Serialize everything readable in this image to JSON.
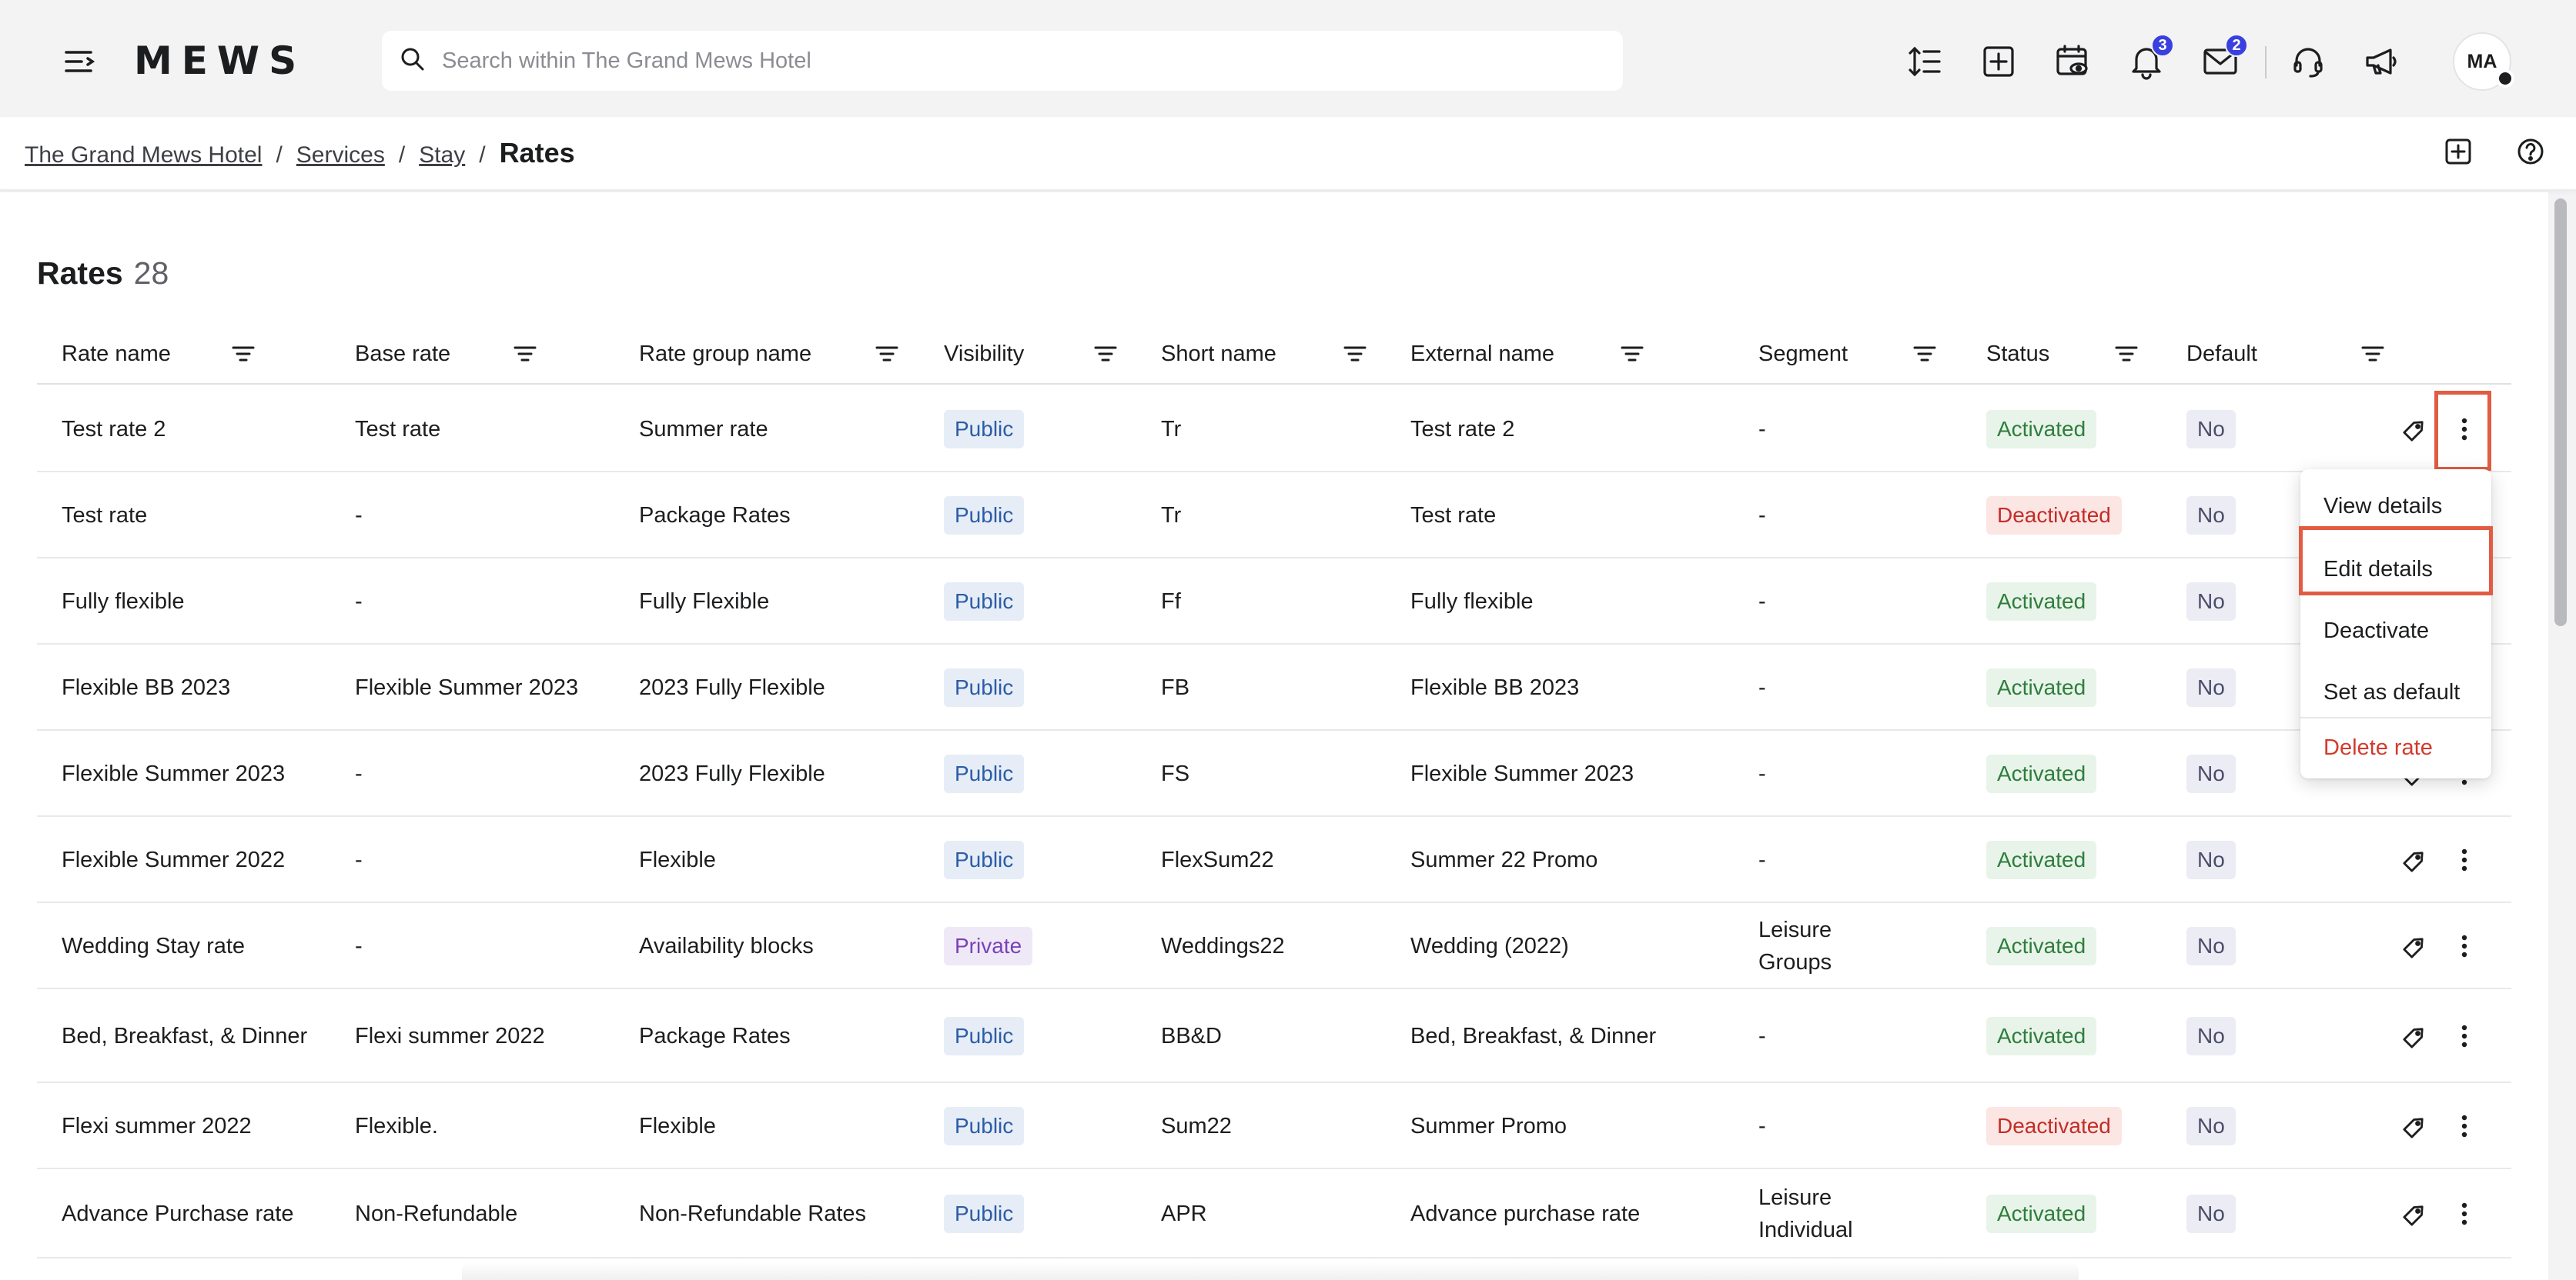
{
  "app": {
    "logo_text": "MEWS",
    "search_placeholder": "Search within The Grand Mews Hotel",
    "notifications_count": "3",
    "messages_count": "2",
    "avatar_initials": "MA"
  },
  "breadcrumb": {
    "items": [
      "The Grand Mews Hotel",
      "Services",
      "Stay"
    ],
    "separator": "/",
    "current": "Rates"
  },
  "page": {
    "title": "Rates",
    "count": "28"
  },
  "table": {
    "columns": [
      "Rate name",
      "Base rate",
      "Rate group name",
      "Visibility",
      "Short name",
      "External name",
      "Segment",
      "Status",
      "Default"
    ],
    "rows": [
      {
        "name": "Test rate 2",
        "base": "Test rate",
        "group": "Summer rate",
        "visibility": "Public",
        "short": "Tr",
        "external": "Test rate 2",
        "segment": "-",
        "status": "Activated",
        "default": "No"
      },
      {
        "name": "Test rate",
        "base": "-",
        "group": "Package Rates",
        "visibility": "Public",
        "short": "Tr",
        "external": "Test rate",
        "segment": "-",
        "status": "Deactivated",
        "default": "No"
      },
      {
        "name": "Fully flexible",
        "base": "-",
        "group": "Fully Flexible",
        "visibility": "Public",
        "short": "Ff",
        "external": "Fully flexible",
        "segment": "-",
        "status": "Activated",
        "default": "No"
      },
      {
        "name": "Flexible BB 2023",
        "base": "Flexible Summer 2023",
        "group": "2023 Fully Flexible",
        "visibility": "Public",
        "short": "FB",
        "external": "Flexible BB 2023",
        "segment": "-",
        "status": "Activated",
        "default": "No"
      },
      {
        "name": "Flexible Summer 2023",
        "base": "-",
        "group": "2023 Fully Flexible",
        "visibility": "Public",
        "short": "FS",
        "external": "Flexible Summer 2023",
        "segment": "-",
        "status": "Activated",
        "default": "No"
      },
      {
        "name": "Flexible Summer 2022",
        "base": "-",
        "group": "Flexible",
        "visibility": "Public",
        "short": "FlexSum22",
        "external": "Summer 22 Promo",
        "segment": "-",
        "status": "Activated",
        "default": "No"
      },
      {
        "name": "Wedding Stay rate",
        "base": "-",
        "group": "Availability blocks",
        "visibility": "Private",
        "short": "Weddings22",
        "external": "Wedding (2022)",
        "segment": "Leisure Groups",
        "status": "Activated",
        "default": "No"
      },
      {
        "name": "Bed, Breakfast, & Dinner",
        "base": "Flexi summer 2022",
        "group": "Package Rates",
        "visibility": "Public",
        "short": "BB&D",
        "external": "Bed, Breakfast, & Dinner",
        "segment": "-",
        "status": "Activated",
        "default": "No"
      },
      {
        "name": "Flexi summer 2022",
        "base": "Flexible.",
        "group": "Flexible",
        "visibility": "Public",
        "short": "Sum22",
        "external": "Summer Promo",
        "segment": "-",
        "status": "Deactivated",
        "default": "No"
      },
      {
        "name": "Advance Purchase rate",
        "base": "Non-Refundable",
        "group": "Non-Refundable Rates",
        "visibility": "Public",
        "short": "APR",
        "external": "Advance purchase rate",
        "segment": "Leisure Individual",
        "status": "Activated",
        "default": "No"
      }
    ]
  },
  "context_menu": {
    "items": [
      "View details",
      "Edit details",
      "Deactivate",
      "Set as default",
      "Delete rate"
    ]
  },
  "colors": {
    "accent": "#3a3fe0",
    "highlight": "#e25c44",
    "activated": "#2f7d3d",
    "deactivated": "#c32d27"
  }
}
